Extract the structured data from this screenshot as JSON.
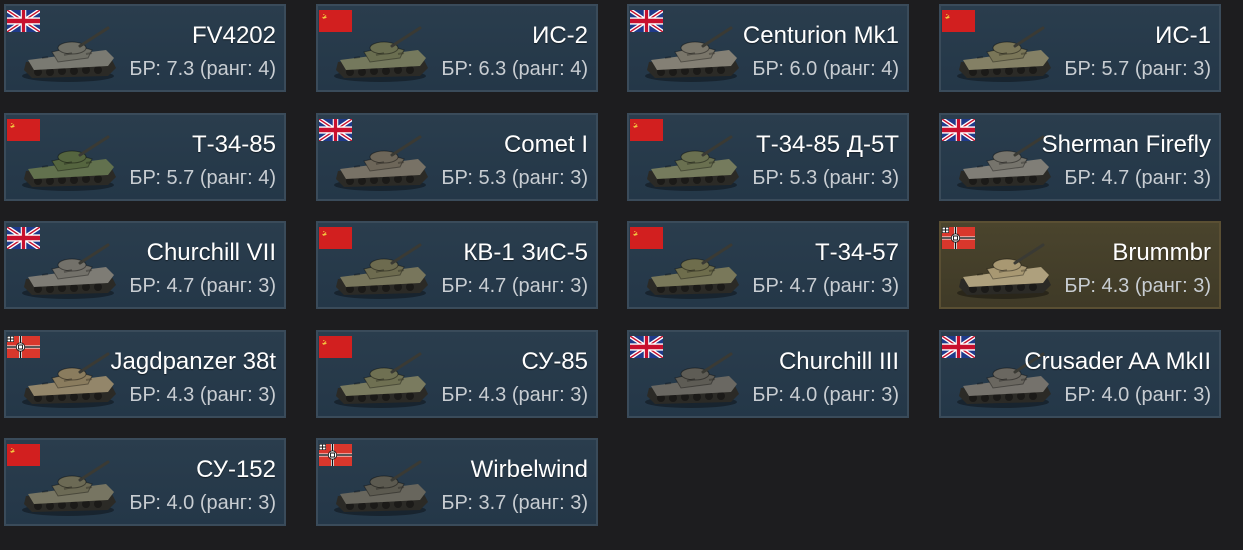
{
  "vehicles": [
    {
      "name": "FV4202",
      "br": "БР: 7.3 (ранг: 4)",
      "nation": "uk",
      "tank_color": "#6f6f66",
      "premium": false
    },
    {
      "name": "ИС-2",
      "br": "БР: 6.3 (ранг: 4)",
      "nation": "ussr",
      "tank_color": "#6a6e50",
      "premium": false
    },
    {
      "name": "Centurion Mk1",
      "br": "БР: 6.0 (ранг: 4)",
      "nation": "uk",
      "tank_color": "#7a766a",
      "premium": false
    },
    {
      "name": "ИС-1",
      "br": "БР: 5.7 (ранг: 3)",
      "nation": "ussr",
      "tank_color": "#7a7658",
      "premium": false
    },
    {
      "name": "Т-34-85",
      "br": "БР: 5.7 (ранг: 4)",
      "nation": "ussr",
      "tank_color": "#55653f",
      "premium": false
    },
    {
      "name": "Comet I",
      "br": "БР: 5.3 (ранг: 3)",
      "nation": "uk",
      "tank_color": "#6d6659",
      "premium": false
    },
    {
      "name": "Т-34-85 Д-5Т",
      "br": "БР: 5.3 (ранг: 3)",
      "nation": "ussr",
      "tank_color": "#6a7050",
      "premium": false
    },
    {
      "name": "Sherman Firefly",
      "br": "БР: 4.7 (ранг: 3)",
      "nation": "uk",
      "tank_color": "#76746c",
      "premium": false
    },
    {
      "name": "Churchill VII",
      "br": "БР: 4.7 (ранг: 3)",
      "nation": "uk",
      "tank_color": "#73716a",
      "premium": false
    },
    {
      "name": "КВ-1 ЗиС-5",
      "br": "БР: 4.7 (ранг: 3)",
      "nation": "ussr",
      "tank_color": "#6d6b4f",
      "premium": false
    },
    {
      "name": "Т-34-57",
      "br": "БР: 4.7 (ранг: 3)",
      "nation": "ussr",
      "tank_color": "#6e6d4c",
      "premium": false
    },
    {
      "name": "Brummbr",
      "br": "БР: 4.3 (ранг: 3)",
      "nation": "germany",
      "tank_color": "#a89872",
      "premium": true
    },
    {
      "name": "Jagdpanzer 38t",
      "br": "БР: 4.3 (ранг: 3)",
      "nation": "germany",
      "tank_color": "#8a7c5e",
      "premium": false
    },
    {
      "name": "СУ-85",
      "br": "БР: 4.3 (ранг: 3)",
      "nation": "ussr",
      "tank_color": "#6f7052",
      "premium": false
    },
    {
      "name": "Churchill III",
      "br": "БР: 4.0 (ранг: 3)",
      "nation": "uk",
      "tank_color": "#5e5c55",
      "premium": false
    },
    {
      "name": "Crusader AA MkII",
      "br": "БР: 4.0 (ранг: 3)",
      "nation": "uk",
      "tank_color": "#6a6760",
      "premium": false
    },
    {
      "name": "СУ-152",
      "br": "БР: 4.0 (ранг: 3)",
      "nation": "ussr",
      "tank_color": "#6c6a55",
      "premium": false
    },
    {
      "name": "Wirbelwind",
      "br": "БР: 3.7 (ранг: 3)",
      "nation": "germany",
      "tank_color": "#5c5a50",
      "premium": false
    }
  ]
}
